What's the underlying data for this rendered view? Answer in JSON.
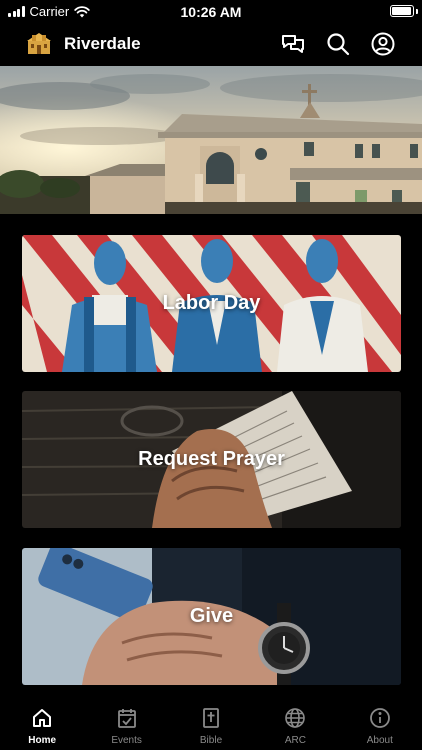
{
  "status_bar": {
    "carrier": "Carrier",
    "time": "10:26 AM",
    "signal_icon": "cellular-signal-icon",
    "wifi_icon": "wifi-icon",
    "battery_icon": "battery-icon",
    "battery_level": 0.95
  },
  "header": {
    "title": "Riverdale",
    "logo_icon": "church-logo-icon",
    "actions": [
      {
        "icon": "chat-bubbles-icon"
      },
      {
        "icon": "search-icon"
      },
      {
        "icon": "profile-icon"
      }
    ]
  },
  "cards": [
    {
      "label": "Labor Day"
    },
    {
      "label": "Request Prayer"
    },
    {
      "label": "Give"
    }
  ],
  "tabs": [
    {
      "label": "Home",
      "icon": "home-icon",
      "active": true
    },
    {
      "label": "Events",
      "icon": "calendar-check-icon",
      "active": false
    },
    {
      "label": "Bible",
      "icon": "bible-icon",
      "active": false
    },
    {
      "label": "ARC",
      "icon": "globe-icon",
      "active": false
    },
    {
      "label": "About",
      "icon": "info-icon",
      "active": false
    }
  ],
  "colors": {
    "background": "#000000",
    "tab_active": "#ffffff",
    "tab_inactive": "#8a8a8a"
  }
}
